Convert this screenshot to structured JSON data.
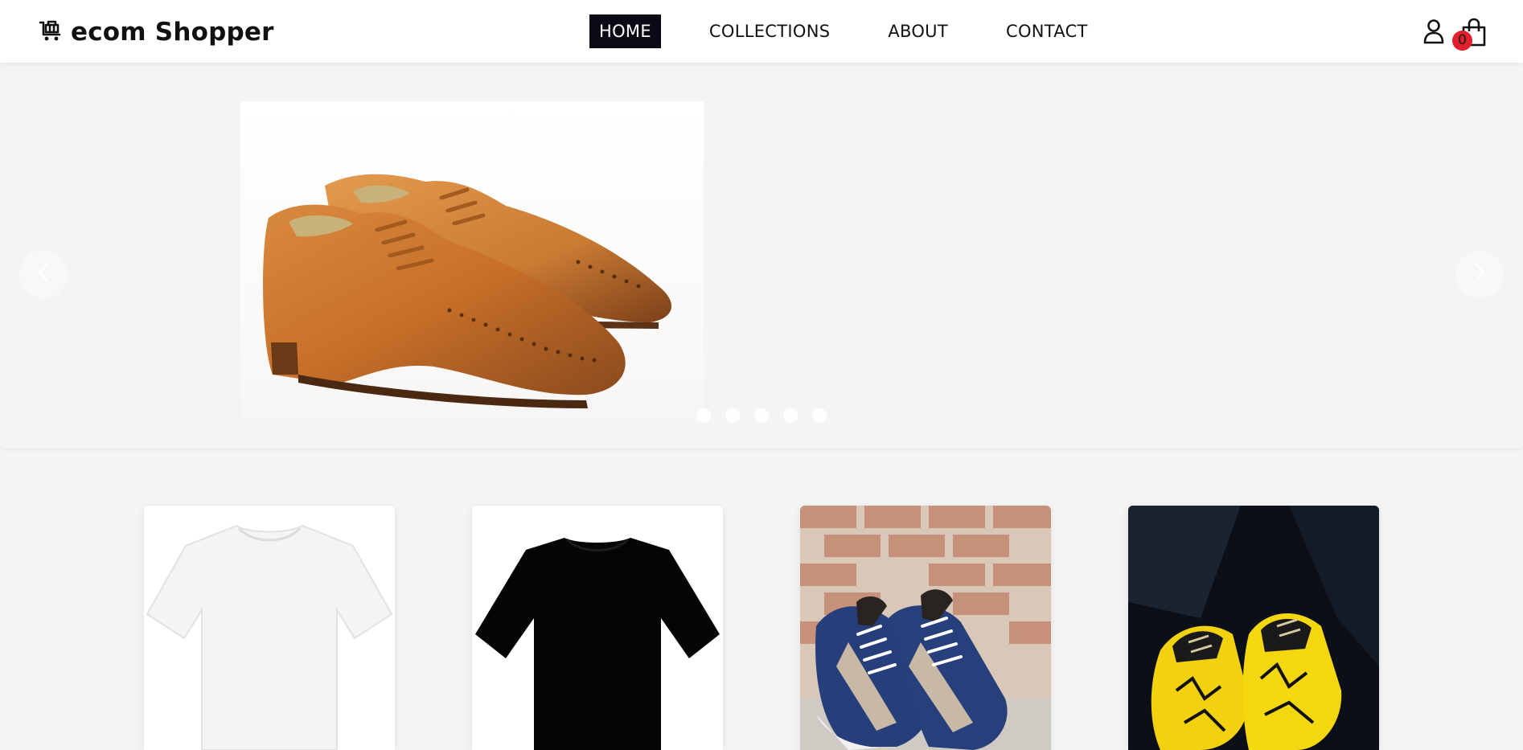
{
  "header": {
    "brand": "ecom Shopper",
    "nav": [
      "HOME",
      "COLLECTIONS",
      "ABOUT",
      "CONTACT"
    ],
    "active_nav": "HOME",
    "cart_count": "0",
    "icons": {
      "logo": "shopping-cart-icon",
      "user": "user-icon",
      "cart": "shopping-bag-icon"
    }
  },
  "carousel": {
    "slide_count": 5,
    "active_slide": 0,
    "slide_image": "brown leather brogue shoes",
    "controls": {
      "prev": "chevron-left-icon",
      "next": "chevron-right-icon"
    }
  },
  "products": [
    {
      "image": "white t-shirt"
    },
    {
      "image": "black t-shirt"
    },
    {
      "image": "blue and grey suede sneakers"
    },
    {
      "image": "yellow and black running shoes"
    }
  ],
  "colors": {
    "accent": "#0a0a14",
    "badge": "#e0212b",
    "background": "#f4f4f4",
    "header": "#ffffff"
  }
}
